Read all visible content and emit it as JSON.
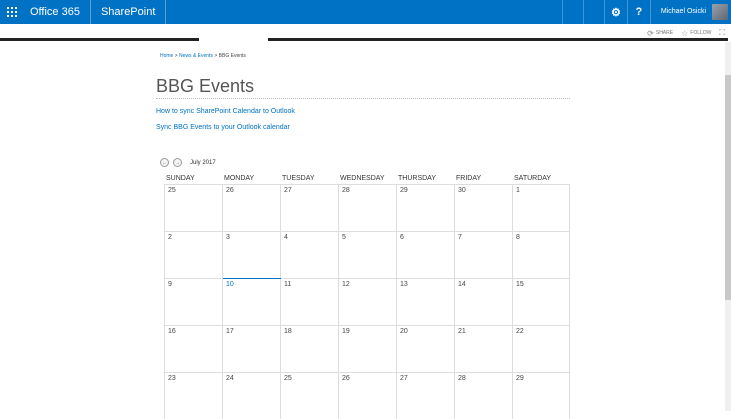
{
  "suitebar": {
    "brand": "Office 365",
    "app": "SharePoint",
    "settings_icon": "gear-icon",
    "help_label": "?",
    "user_name": "Michael Osicki",
    "color": "#0072c6"
  },
  "ribbon": {
    "share_label": "SHARE",
    "follow_label": "FOLLOW"
  },
  "breadcrumb": {
    "home": "Home",
    "sep1": " > ",
    "news": "News & Events",
    "sep2": " > ",
    "current": "BBG Events"
  },
  "page": {
    "title": "BBG Events",
    "link1": "How to sync SharePoint Calendar to Outlook",
    "link2": "Sync BBG Events to your Outlook calendar"
  },
  "calendar": {
    "month_label": "July 2017",
    "prev_icon": "arrow-left-icon",
    "next_icon": "arrow-right-icon",
    "days": [
      "SUNDAY",
      "MONDAY",
      "TUESDAY",
      "WEDNESDAY",
      "THURSDAY",
      "FRIDAY",
      "SATURDAY"
    ],
    "weeks": [
      [
        "25",
        "26",
        "27",
        "28",
        "29",
        "30",
        "1"
      ],
      [
        "2",
        "3",
        "4",
        "5",
        "6",
        "7",
        "8"
      ],
      [
        "9",
        "10",
        "11",
        "12",
        "13",
        "14",
        "15"
      ],
      [
        "16",
        "17",
        "18",
        "19",
        "20",
        "21",
        "22"
      ],
      [
        "23",
        "24",
        "25",
        "26",
        "27",
        "28",
        "29"
      ]
    ],
    "today": "10"
  }
}
